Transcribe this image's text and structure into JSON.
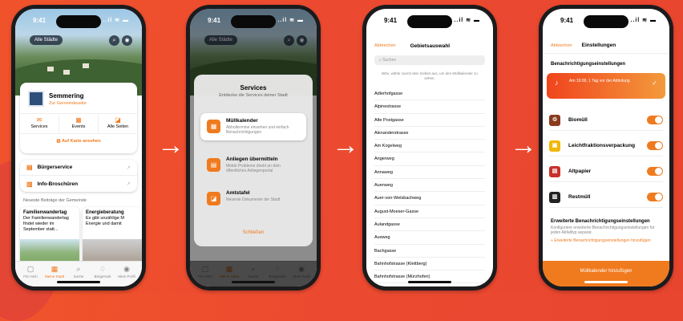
{
  "status": {
    "time": "9:41",
    "icons": "..il ≋ ▬"
  },
  "phone1": {
    "city_pill": "Alle Städte",
    "org_name": "Semmering",
    "org_link": "Zur Gemeindeseite",
    "quick": [
      {
        "icon": "✉",
        "label": "Services"
      },
      {
        "icon": "▦",
        "label": "Events"
      },
      {
        "icon": "◪",
        "label": "Alle Seiten"
      }
    ],
    "map_link": "Auf Karte ansehen",
    "links": [
      {
        "icon": "▤",
        "label": "Bürgerservice"
      },
      {
        "icon": "▥",
        "label": "Info-Broschüren"
      }
    ],
    "section": "Neueste Beiträge der Gemeinde",
    "news": [
      {
        "title": "Familienwandertag",
        "text": "Der Familienwandertag findet wieder im September statt..."
      },
      {
        "title": "Energieberatung",
        "text": "Es gibt unzählige M Energie und damit"
      }
    ],
    "tabs": [
      {
        "icon": "▢",
        "label": "Für mich"
      },
      {
        "icon": "▦",
        "label": "Meine Stadt"
      },
      {
        "icon": "⌕",
        "label": "Suche"
      },
      {
        "icon": "♢",
        "label": "Bürgernah"
      },
      {
        "icon": "◉",
        "label": "Mein Profil"
      }
    ]
  },
  "phone2": {
    "title": "Services",
    "subtitle": "Entdecke die Services deiner Stadt",
    "services": [
      {
        "icon": "▦",
        "title": "Müllkalender",
        "desc": "Abholtermine einsehen und einfach Benachrichtigungen"
      },
      {
        "icon": "▤",
        "title": "Anliegen übermitteln",
        "desc": "Melde Probleme direkt an dein öffentliches Anliegenportal"
      },
      {
        "icon": "◪",
        "title": "Amtstafel",
        "desc": "Neueste Dokumente der Stadt"
      }
    ],
    "close": "Schließen"
  },
  "phone3": {
    "back": "Abbrechen",
    "title": "Gebietsauswahl",
    "search_placeholder": "Suchen",
    "hint": "Bitte, wähle zuerst dein Gebiet aus, um den Müllkalender zu sehen.",
    "streets": [
      "Adlerhofgasse",
      "Alpinestrasse",
      "Alte Postgasse",
      "Alexanderstrasse",
      "Am Kogelweg",
      "Angerweg",
      "Annaweg",
      "Auenweg",
      "Auer-von-Welsbachweg",
      "August-Moeser-Gasse",
      "Aulandgasse",
      "Ausweg",
      "Bachgasse",
      "Bahnhofstrasse (Klettberg)",
      "Bahnhofstrasse (Mürzhofen)"
    ]
  },
  "phone4": {
    "back": "Abbrechen",
    "title": "Einstellungen",
    "section": "Benachrichtigungseinstellungen",
    "banner": "Am 19:00, 1 Tag vor der Abholung",
    "categories": [
      {
        "icon": "♲",
        "label": "Biomüll",
        "color": "#8a3b1e"
      },
      {
        "icon": "▣",
        "label": "Leichtfraktionsverpackung",
        "color": "#f2b705"
      },
      {
        "icon": "▤",
        "label": "Altpapier",
        "color": "#c8312a"
      },
      {
        "icon": "▥",
        "label": "Restmüll",
        "color": "#222222"
      }
    ],
    "ext_title": "Erweiterte Benachrichtigungseinstellungen",
    "ext_desc": "Konfiguriere erweiterte Benachrichtigungseinstellungen für jeden Abfalltyp separat.",
    "ext_link": "Erweiterte Benachrichtigungseinstellungen hinzufügen",
    "save": "Müllkalender hinzufügen"
  },
  "colors": {
    "accent": "#f07a1e",
    "background": "#ec4a30"
  }
}
